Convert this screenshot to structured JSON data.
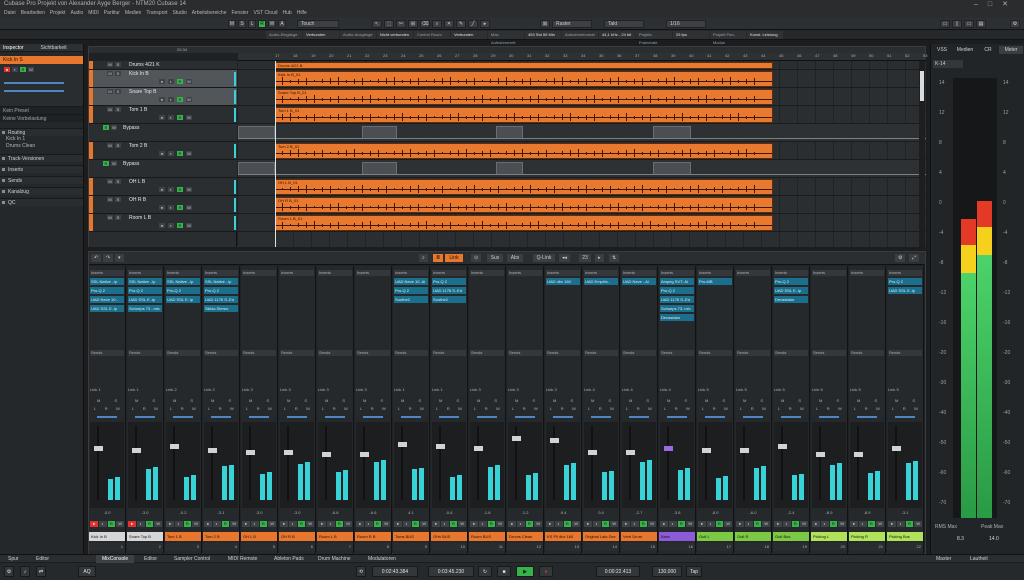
{
  "window": {
    "title": "Cubase Pro Projekt von Alexander Ayge Berger - NTM20 Cubase 14"
  },
  "menu": [
    "Datei",
    "Bearbeiten",
    "Projekt",
    "Audio",
    "MIDI",
    "Partitur",
    "Medien",
    "Transport",
    "Studio",
    "Arbeitsbereiche",
    "Fenster",
    "VST Cloud",
    "Hub",
    "Hilfe"
  ],
  "toolbar": {
    "m": "M",
    "s": "S",
    "l": "L",
    "r": "R",
    "w": "W",
    "a": "A",
    "touch": "Touch",
    "raster": "Raster",
    "takt": "Takt",
    "quant": "1/16"
  },
  "infobar": [
    "Audio-Eingänge",
    "Verbunden",
    "Audio-Ausgänge",
    "Nicht verbunden",
    "Control Room",
    "Verbunden",
    "Max. Aufnahmezeit",
    "453 Std 59 Min",
    "Aufnahmeformat",
    "44,1 kHz - 24 bit",
    "Projekt-Framerate",
    "25 fps",
    "Projekt Pan-Modus",
    "Konst. Leistung"
  ],
  "inspector": {
    "tab1": "Inspector",
    "tab2": "Sichtbarkeit",
    "track": "Kick In S",
    "sections": [
      "Routing",
      "Track-Versionen",
      "Inserts",
      "Sends",
      "Kanalzug",
      "QC"
    ],
    "routing_in": "Kick In 1",
    "routing_out": "Drums Clean",
    "input_label": "Keine Vorbelastung",
    "eq": "Kein Preset"
  },
  "project": {
    "position": "20:34",
    "folder": "Eingangs-changeguarkanäle",
    "tracks": [
      {
        "name": "Drums 4/21 K",
        "type": "folder"
      },
      {
        "name": "Kick In B",
        "type": "audio"
      },
      {
        "name": "Snare Top B",
        "type": "audio"
      },
      {
        "name": "Tom 1 B",
        "type": "audio"
      },
      {
        "name": "Bypass",
        "type": "auto"
      },
      {
        "name": "Tom 2 B",
        "type": "audio"
      },
      {
        "name": "Bypass",
        "type": "auto"
      },
      {
        "name": "OH L B",
        "type": "audio"
      },
      {
        "name": "OH R B",
        "type": "audio"
      },
      {
        "name": "Room L B",
        "type": "audio"
      }
    ],
    "clips": [
      "Drums 4/21 B",
      "Kick In B_01",
      "Snare Top B_01",
      "Tom 1 B_01",
      "",
      "Tom 2 B_01",
      "",
      "OH L B_01",
      "OH R B_01",
      "Room L B_01"
    ],
    "ruler": [
      "17",
      "18",
      "19",
      "20",
      "21",
      "22",
      "23",
      "24",
      "25",
      "26",
      "27",
      "28",
      "29",
      "30",
      "31",
      "32",
      "33",
      "34",
      "35",
      "36",
      "37",
      "38",
      "39",
      "40",
      "41",
      "42",
      "43",
      "44",
      "45",
      "46",
      "47",
      "48",
      "49",
      "50",
      "51",
      "52",
      "53",
      "54",
      "55"
    ]
  },
  "mixer": {
    "toolbar": {
      "link": "Link",
      "sus": "Sus",
      "abs": "Abs",
      "qlink": "Q-Link",
      "value": "23"
    },
    "channels": [
      {
        "name": "Kick In B",
        "num": "1",
        "color": "#d4d6d8",
        "inserts": [
          "SSL Native ..ip",
          "Pro-Q 2",
          "UAD Neve 10..",
          "UAD SSL E..ip"
        ],
        "sends": "Link 1",
        "rec": true,
        "vol": "-0.0",
        "fader": 62
      },
      {
        "name": "Snare Top B",
        "num": "2",
        "color": "#d4d6d8",
        "inserts": [
          "SSL Native ..ip",
          "Pro-Q 2",
          "UAD SSL E..ip",
          "Schoeps 73 ..mic"
        ],
        "sends": "Link 1",
        "rec": true,
        "vol": "-3.0",
        "fader": 60
      },
      {
        "name": "Tom 1 B",
        "num": "3",
        "color": "#e8772d",
        "inserts": [
          "SSL Native ..ip",
          "Pro-Q 2",
          "UAD SSL E..ip"
        ],
        "sends": "Link 2",
        "rec": false,
        "vol": "-0.2",
        "fader": 64
      },
      {
        "name": "Tom 2 B",
        "num": "4",
        "color": "#e8772d",
        "inserts": [
          "SSL Native ..ip",
          "Pro-Q 2",
          "UAD 1176 S..Ed",
          "Silicia Stereo"
        ],
        "sends": "Link 2",
        "rec": false,
        "vol": "-3.1",
        "fader": 60
      },
      {
        "name": "OH L B",
        "num": "5",
        "color": "#e8772d",
        "inserts": [],
        "sends": "Link 3",
        "rec": false,
        "vol": "-3.0",
        "fader": 58
      },
      {
        "name": "OH R B",
        "num": "6",
        "color": "#e8772d",
        "inserts": [],
        "sends": "Link 3",
        "rec": false,
        "vol": "-3.0",
        "fader": 58
      },
      {
        "name": "Room L B",
        "num": "7",
        "color": "#e8772d",
        "inserts": [],
        "sends": "Link 3",
        "rec": false,
        "vol": "-6.6",
        "fader": 56
      },
      {
        "name": "Room R B",
        "num": "8",
        "color": "#e8772d",
        "inserts": [],
        "sends": "Link 3",
        "rec": false,
        "vol": "-6.6",
        "fader": 56
      },
      {
        "name": "Toms BUS",
        "num": "9",
        "color": "#e8772d",
        "inserts": [
          "UAD Neve 10..Ai",
          "Pro-Q 2",
          "Soothe2"
        ],
        "sends": "Link 1",
        "rec": false,
        "vol": "4.1",
        "fader": 66
      },
      {
        "name": "OHs BUS",
        "num": "10",
        "color": "#e8772d",
        "inserts": [
          "Pro-Q 2",
          "UAD 1176 S..Ed",
          "Soothe2"
        ],
        "sends": "Link 1",
        "rec": false,
        "vol": "-0.6",
        "fader": 64
      },
      {
        "name": "Room BUS",
        "num": "11",
        "color": "#e8772d",
        "inserts": [],
        "sends": "Link 3",
        "rec": false,
        "vol": "-1.6",
        "fader": 62
      },
      {
        "name": "Drums Clean",
        "num": "12",
        "color": "#e8772d",
        "inserts": [],
        "sends": "Link 3",
        "rec": false,
        "vol": "-1.2",
        "fader": 72
      },
      {
        "name": "KS Pll dbx 160",
        "num": "13",
        "color": "#e8772d",
        "inserts": [
          "UAD dbx 160"
        ],
        "sends": "Link 3",
        "rec": false,
        "vol": "-9.4",
        "fader": 70
      },
      {
        "name": "Original Lala Dev",
        "num": "14",
        "color": "#e8772d",
        "inserts": [
          "UAD Empiric.."
        ],
        "sends": "Link 4",
        "rec": false,
        "vol": "0.4",
        "fader": 58
      },
      {
        "name": "Verb Drum",
        "num": "15",
        "color": "#e8772d",
        "inserts": [
          "UAD Neve ..Ai"
        ],
        "sends": "Link 4",
        "rec": false,
        "vol": "-2.7",
        "fader": 58
      },
      {
        "name": "Bass",
        "num": "16",
        "color": "#8c5bd9",
        "inserts": [
          "Ampeg SVT..Ai",
          "Pro-Q 2",
          "UAD 1176 S..Ed",
          "Schoeps 73..mic",
          "Devastator"
        ],
        "sends": "Link 4",
        "rec": false,
        "vol": "-3.8",
        "fader": 62
      },
      {
        "name": "Guit L",
        "num": "17",
        "color": "#7cc943",
        "inserts": [
          "Pro-MB"
        ],
        "sends": "Link 5",
        "rec": false,
        "vol": "-8.0",
        "fader": 60
      },
      {
        "name": "Guit R",
        "num": "18",
        "color": "#7cc943",
        "inserts": [],
        "sends": "Link 5",
        "rec": false,
        "vol": "-6.0",
        "fader": 60
      },
      {
        "name": "Guit Bus",
        "num": "19",
        "color": "#7cc943",
        "inserts": [
          "Pro-Q 2",
          "UAD SSL E..ip",
          "Devastator"
        ],
        "sends": "Link 5",
        "rec": false,
        "vol": "-2.4",
        "fader": 64
      },
      {
        "name": "Picking L",
        "num": "20",
        "color": "#b0e35a",
        "inserts": [],
        "sends": "Link 5",
        "rec": false,
        "vol": "-8.9",
        "fader": 56
      },
      {
        "name": "Picking R",
        "num": "21",
        "color": "#b0e35a",
        "inserts": [],
        "sends": "Link 5",
        "rec": false,
        "vol": "-8.9",
        "fader": 56
      },
      {
        "name": "Picking Bus",
        "num": "22",
        "color": "#b0e35a",
        "inserts": [
          "Pro-Q 2",
          "UAD SSL E..ip"
        ],
        "sends": "Link 5",
        "rec": false,
        "vol": "-3.1",
        "fader": 62
      }
    ],
    "labels": {
      "inserts": "Inserts",
      "sends": "Sends",
      "m": "M",
      "s": "S",
      "l": "L",
      "r": "R",
      "w": "W"
    }
  },
  "rightpanel": {
    "tabs": [
      "VSS",
      "Medien",
      "CR",
      "Meter"
    ],
    "mode": "K-14",
    "scale": [
      "14",
      "12",
      "8",
      "4",
      "0",
      "-4",
      "-8",
      "-12",
      "-16",
      "-20",
      "-30",
      "-40",
      "-50",
      "-60",
      "-70"
    ],
    "rms_label": "RMS Max",
    "peak_label": "Peak Max",
    "rms": "8.3",
    "peak": "14.0",
    "level_l": 0.68,
    "level_r": 0.72
  },
  "bottomtabs": {
    "left": [
      "Spur",
      "Editor"
    ],
    "main": [
      "MixConsole",
      "Editor",
      "Sampler Control",
      "MIDI Remote",
      "Ableton Pads",
      "Drum Machine",
      "Modulatoren"
    ],
    "right": [
      "Master",
      "Lautheit"
    ]
  },
  "transport": {
    "left_locator": "0:02:43.384",
    "right_locator": "0:03:45.230",
    "position": "0:00:22.413",
    "tempo": "130.000",
    "signature": "Tap"
  }
}
